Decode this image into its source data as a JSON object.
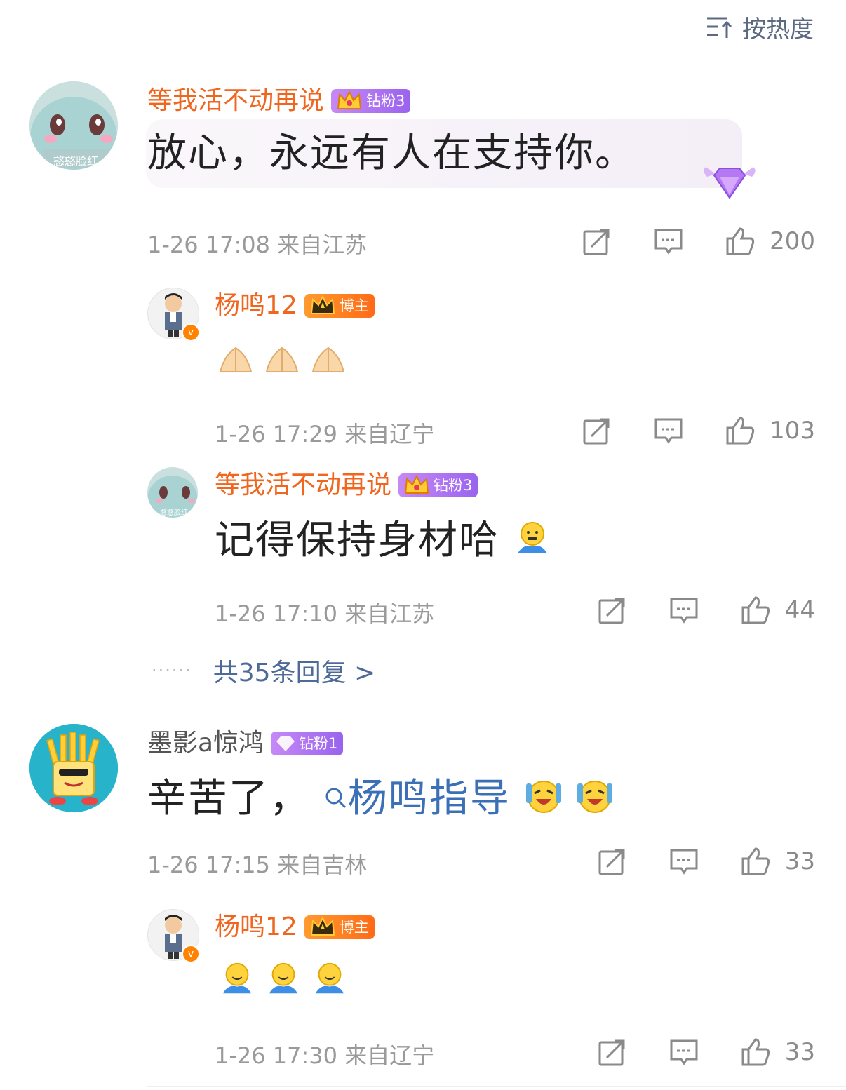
{
  "sort": {
    "label": "按热度"
  },
  "comments": [
    {
      "user": "等我活不动再说",
      "badge": "钻粉3",
      "avatar_text": "憨憨脸红",
      "text": "放心，永远有人在支持你。",
      "meta": "1-26 17:08  来自江苏",
      "likes": "200",
      "replies": [
        {
          "user": "杨鸣12",
          "badge": "博主",
          "meta": "1-26 17:29  来自辽宁",
          "likes": "103",
          "emoji": [
            "pray",
            "pray",
            "pray"
          ]
        },
        {
          "user": "等我活不动再说",
          "badge": "钻粉3",
          "avatar_text": "憨憨脸红",
          "text": "记得保持身材哈",
          "meta": "1-26 17:10  来自江苏",
          "likes": "44"
        }
      ],
      "more_replies": "共35条回复 >"
    },
    {
      "user": "墨影a惊鸿",
      "badge": "钻粉1",
      "text_prefix": "辛苦了，",
      "topic": "杨鸣指导",
      "meta": "1-26 17:15  来自吉林",
      "likes": "33",
      "replies": [
        {
          "user": "杨鸣12",
          "badge": "博主",
          "meta": "1-26 17:30  来自辽宁",
          "likes": "33",
          "emoji": [
            "hug",
            "hug",
            "hug"
          ]
        }
      ]
    }
  ],
  "colors": {
    "name_orange": "#f0661f",
    "topic_blue": "#3b6fb6",
    "badge_purple": "#9a63ee",
    "badge_orange": "#ff6b17"
  }
}
